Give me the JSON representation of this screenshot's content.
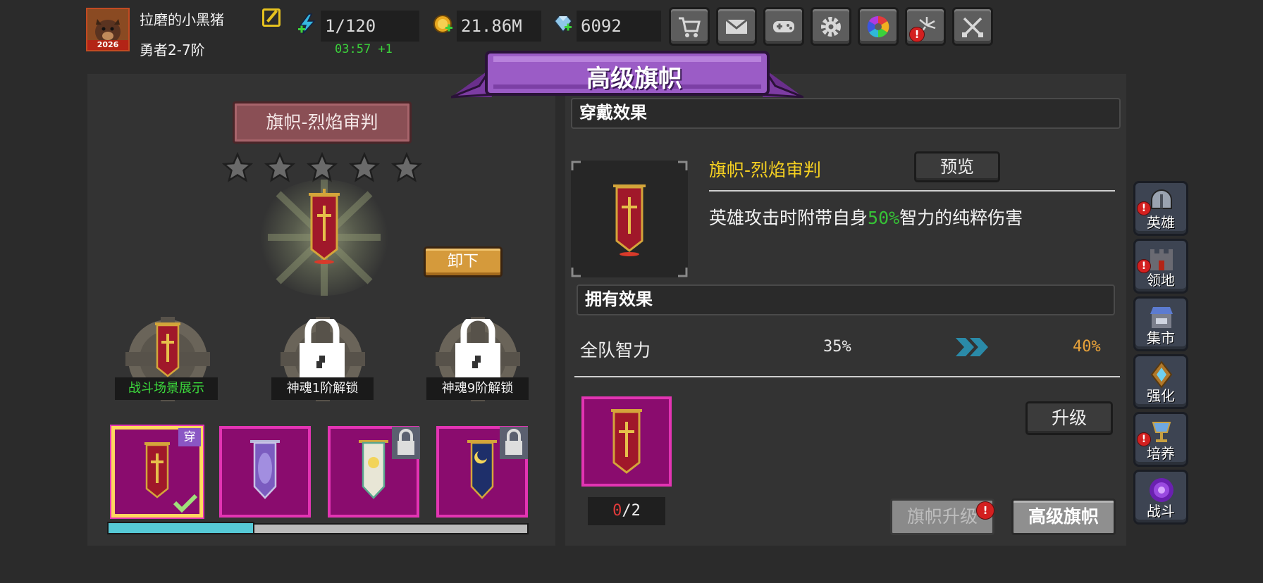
{
  "player": {
    "name": "拉磨的小黑猪",
    "rank": "勇者2-7阶",
    "avatar_badge": "2026"
  },
  "resources": {
    "stamina": "1/120",
    "stamina_timer": "03:57 +1",
    "gold": "21.86M",
    "gems": "6092"
  },
  "top_buttons": [
    {
      "icon": "shop-cart-icon"
    },
    {
      "icon": "mail-icon"
    },
    {
      "icon": "gamepad-icon"
    },
    {
      "icon": "settings-gear-icon"
    },
    {
      "icon": "color-wheel-icon"
    },
    {
      "icon": "fireworks-icon",
      "alert": "!"
    },
    {
      "icon": "crossed-swords-icon"
    }
  ],
  "page_title": "高级旗帜",
  "left": {
    "banner_name": "旗帜-烈焰审判",
    "stars": 5,
    "unequip_label": "卸下",
    "pedestals": [
      {
        "label": "战斗场景展示",
        "color": "#3cdb3c",
        "locked": false
      },
      {
        "label": "神魂1阶解锁",
        "color": "#f0f0f0",
        "locked": true
      },
      {
        "label": "神魂9阶解锁",
        "color": "#f0f0f0",
        "locked": true
      }
    ],
    "slots": [
      {
        "name": "flame-judgment-banner",
        "selected": true,
        "tag": "穿",
        "locked": false
      },
      {
        "name": "violet-shield-banner",
        "selected": false,
        "locked": false
      },
      {
        "name": "white-sun-banner",
        "selected": false,
        "locked": true
      },
      {
        "name": "navy-moon-banner",
        "selected": false,
        "locked": true
      }
    ],
    "progress": 0.35
  },
  "right": {
    "wear_effect_title": "穿戴效果",
    "item_name": "旗帜-烈焰审判",
    "preview_label": "预览",
    "desc_prefix": "英雄攻击时附带自身",
    "desc_pct": "50%",
    "desc_suffix": "智力的纯粹伤害",
    "own_effect_title": "拥有效果",
    "stat_name": "全队智力",
    "stat_old": "35%",
    "stat_new": "40%",
    "material_have": "0",
    "material_need": "/2",
    "upgrade_label": "升级",
    "banner_upgrade_label": "旗帜升级",
    "advanced_banner_label": "高级旗帜"
  },
  "side_nav": [
    {
      "label": "英雄",
      "icon": "helmet-icon",
      "alert": true
    },
    {
      "label": "领地",
      "icon": "castle-icon",
      "alert": true
    },
    {
      "label": "集市",
      "icon": "market-stall-icon",
      "alert": false
    },
    {
      "label": "强化",
      "icon": "crystal-emblem-icon",
      "alert": false
    },
    {
      "label": "培养",
      "icon": "chalice-icon",
      "alert": true
    },
    {
      "label": "战斗",
      "icon": "portal-icon",
      "alert": false
    }
  ],
  "colors": {
    "accent_purple": "#8e4cb0",
    "slot_magenta": "#8a0c6e",
    "slot_border": "#e334b3",
    "gold_text": "#f5d021",
    "green_text": "#36c236",
    "orange_text": "#e8a23a",
    "alert_red": "#d32020"
  }
}
